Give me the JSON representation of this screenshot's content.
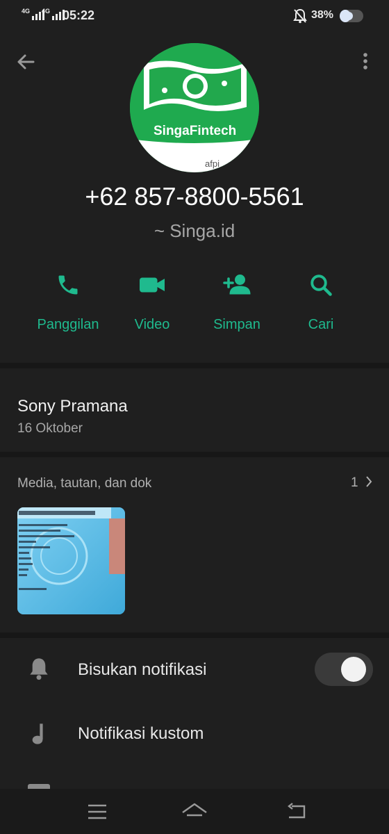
{
  "status_bar": {
    "network_1": "4G",
    "network_2": "4G",
    "time": "05:22",
    "battery": "38%"
  },
  "contact": {
    "avatar_text": "SingaFintech",
    "phone": "+62 857-8800-5561",
    "alias": "~ Singa.id"
  },
  "actions": [
    {
      "label": "Panggilan",
      "icon": "phone-icon"
    },
    {
      "label": "Video",
      "icon": "video-camera-icon"
    },
    {
      "label": "Simpan",
      "icon": "add-person-icon"
    },
    {
      "label": "Cari",
      "icon": "search-icon"
    }
  ],
  "about": {
    "name": "Sony Pramana",
    "date": "16 Oktober"
  },
  "media": {
    "title": "Media, tautan, dan dok",
    "count": "1"
  },
  "settings": [
    {
      "label": "Bisukan notifikasi",
      "icon": "bell-icon",
      "toggle_on": true
    },
    {
      "label": "Notifikasi kustom",
      "icon": "music-note-icon"
    }
  ],
  "colors": {
    "accent": "#1fba8e",
    "background": "#1f1f1f",
    "avatar_green": "#1faa4f"
  }
}
